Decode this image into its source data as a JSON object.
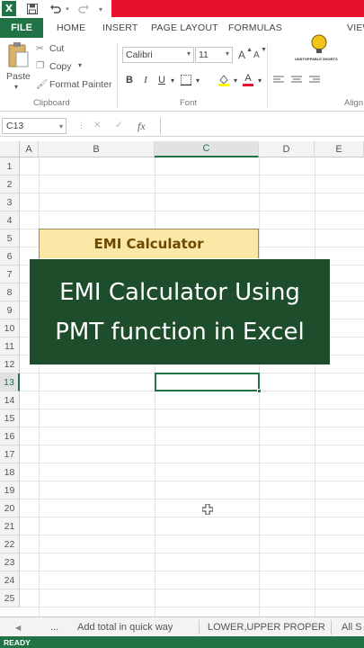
{
  "ribbon_tabs": {
    "file": "FILE",
    "items": [
      "HOME",
      "INSERT",
      "PAGE LAYOUT",
      "FORMULAS",
      "VIEW"
    ]
  },
  "clipboard": {
    "cut": "Cut",
    "copy": "Copy",
    "paste": "Paste",
    "format_painter": "Format Painter",
    "group_label": "Clipboard"
  },
  "font": {
    "name": "Calibri",
    "size": "11",
    "bold": "B",
    "italic": "I",
    "underline": "U",
    "grow": "A",
    "shrink": "A",
    "font_color": "A",
    "group_label": "Font"
  },
  "alignment": {
    "group_label": "Align"
  },
  "logo_text": "UNSTOPPABLE SHORTS",
  "formula_bar": {
    "name_box": "C13",
    "fx": "fx",
    "cancel": "✕",
    "enter": "✓"
  },
  "columns": [
    "A",
    "B",
    "C",
    "D",
    "E"
  ],
  "rows": [
    "1",
    "2",
    "3",
    "4",
    "5",
    "6",
    "7",
    "8",
    "9",
    "10",
    "11",
    "12",
    "13",
    "14",
    "15",
    "16",
    "17",
    "18",
    "19",
    "20",
    "21",
    "22",
    "23",
    "24",
    "25"
  ],
  "cell_title": "EMI Calculator",
  "overlay": {
    "line1": "EMI Calculator Using",
    "line2": "PMT function in Excel"
  },
  "sheet_tabs": [
    "...",
    "Add total in quick way",
    "LOWER,UPPER PROPER",
    "All S"
  ],
  "status": "READY",
  "colors": {
    "excel_green": "#217346",
    "title_red": "#e8112d",
    "overlay_green": "#1e4d2b",
    "emi_fill": "#fbe7a6"
  }
}
